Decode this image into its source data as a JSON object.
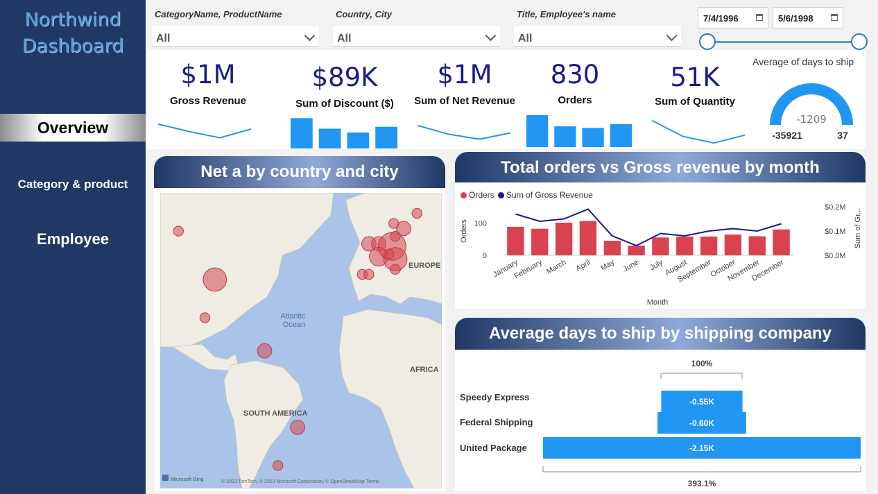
{
  "app": {
    "title_line1": "Northwind",
    "title_line2": "Dashboard"
  },
  "nav": {
    "overview": "Overview",
    "category": "Category & product",
    "employee": "Employee"
  },
  "filters": {
    "category": {
      "label": "CategoryName, ProductName",
      "value": "All"
    },
    "country": {
      "label": "Country, City",
      "value": "All"
    },
    "employee": {
      "label": "Title, Employee's name",
      "value": "All"
    },
    "date_start": "7/4/1996",
    "date_end": "5/6/1998"
  },
  "kpis": {
    "gross_revenue": {
      "value": "$1M",
      "label": "Gross Revenue"
    },
    "discount": {
      "value": "$89K",
      "label": "Sum of Discount ($)"
    },
    "net_revenue": {
      "value": "$1M",
      "label": "Sum of Net Revenue"
    },
    "orders": {
      "value": "830",
      "label": "Orders"
    },
    "quantity": {
      "value": "51K",
      "label": "Sum of Quantity"
    }
  },
  "gauge": {
    "title": "Average of days to ship",
    "value": "-1209",
    "min": "-35921",
    "max": "37",
    "fill_fraction": 1.0
  },
  "map_panel": {
    "title": "Net a by country and city",
    "ocean_label": "Atlantic Ocean",
    "europe_label": "EUROPE",
    "south_america_label": "SOUTH AMERICA",
    "africa_label": "AFRICA",
    "bing_label": "Microsoft Bing",
    "copyright": "© 2023 TomTom, © 2023 Microsoft Corporation, © OpenStreetMap  Terms"
  },
  "colors": {
    "sidebar": "#1f3864",
    "accent": "#2196f3",
    "orders_bar": "#d9434f",
    "revenue_line": "#1a1a8c",
    "kpi_text": "#1a1a8c"
  },
  "chart_data": [
    {
      "type": "bar+line",
      "title": "Total orders vs Gross revenue by month",
      "xlabel": "Month",
      "ylabel": "Orders",
      "y2label": "Sum of Gr...",
      "categories": [
        "January",
        "February",
        "March",
        "April",
        "May",
        "June",
        "July",
        "August",
        "September",
        "October",
        "November",
        "December"
      ],
      "series": [
        {
          "name": "Orders",
          "type": "bar",
          "axis": "left",
          "values": [
            88,
            82,
            101,
            106,
            45,
            30,
            55,
            58,
            58,
            64,
            59,
            80
          ]
        },
        {
          "name": "Sum of Gross Revenue",
          "type": "line",
          "axis": "right",
          "values": [
            0.17,
            0.14,
            0.15,
            0.19,
            0.08,
            0.04,
            0.09,
            0.08,
            0.1,
            0.11,
            0.1,
            0.13
          ]
        }
      ],
      "yticks": [
        "0",
        "100"
      ],
      "ylim": [
        0,
        150
      ],
      "y2ticks": [
        "$0.0M",
        "$0.1M",
        "$0.2M"
      ],
      "y2lim": [
        0,
        0.2
      ],
      "legend_position": "top-left"
    },
    {
      "type": "bar",
      "orientation": "horizontal",
      "title": "Average days to ship by shipping company",
      "categories": [
        "Speedy Express",
        "Federal Shipping",
        "United Package"
      ],
      "values": [
        -550,
        -600,
        -2150
      ],
      "value_labels": [
        "-0.55K",
        "-0.60K",
        "-2.15K"
      ],
      "top_reference": "100%",
      "bottom_reference": "393.1%"
    }
  ],
  "sparklines": {
    "gross": [
      0.3,
      0.6,
      0.85,
      0.5
    ],
    "discount": [
      0.95,
      0.62,
      0.5,
      0.68
    ],
    "net": [
      0.3,
      0.65,
      0.85,
      0.6
    ],
    "orders": [
      1.0,
      0.65,
      0.6,
      0.72
    ],
    "quantity": [
      0.1,
      0.7,
      0.95,
      0.65
    ]
  },
  "map_bubbles": [
    {
      "lon": -119,
      "lat": 57,
      "size": 1
    },
    {
      "lon": -97,
      "lat": 38,
      "size": 4
    },
    {
      "lon": -103,
      "lat": 23,
      "size": 1
    },
    {
      "lon": -67,
      "lat": 10,
      "size": 2
    },
    {
      "lon": -47,
      "lat": -20,
      "size": 2
    },
    {
      "lon": -59,
      "lat": -35,
      "size": 1
    },
    {
      "lon": -4,
      "lat": 52,
      "size": 2
    },
    {
      "lon": -8,
      "lat": 40,
      "size": 1
    },
    {
      "lon": -4,
      "lat": 40,
      "size": 1
    },
    {
      "lon": 2,
      "lat": 52,
      "size": 2
    },
    {
      "lon": 2,
      "lat": 47,
      "size": 3
    },
    {
      "lon": 10,
      "lat": 51,
      "size": 5
    },
    {
      "lon": 12,
      "lat": 46,
      "size": 4
    },
    {
      "lon": 12,
      "lat": 42,
      "size": 1
    },
    {
      "lon": 8,
      "lat": 48,
      "size": 1
    },
    {
      "lon": 12,
      "lat": 55,
      "size": 1
    },
    {
      "lon": 17,
      "lat": 58,
      "size": 2
    },
    {
      "lon": 11,
      "lat": 60,
      "size": 1
    },
    {
      "lon": 25,
      "lat": 64,
      "size": 1
    }
  ]
}
